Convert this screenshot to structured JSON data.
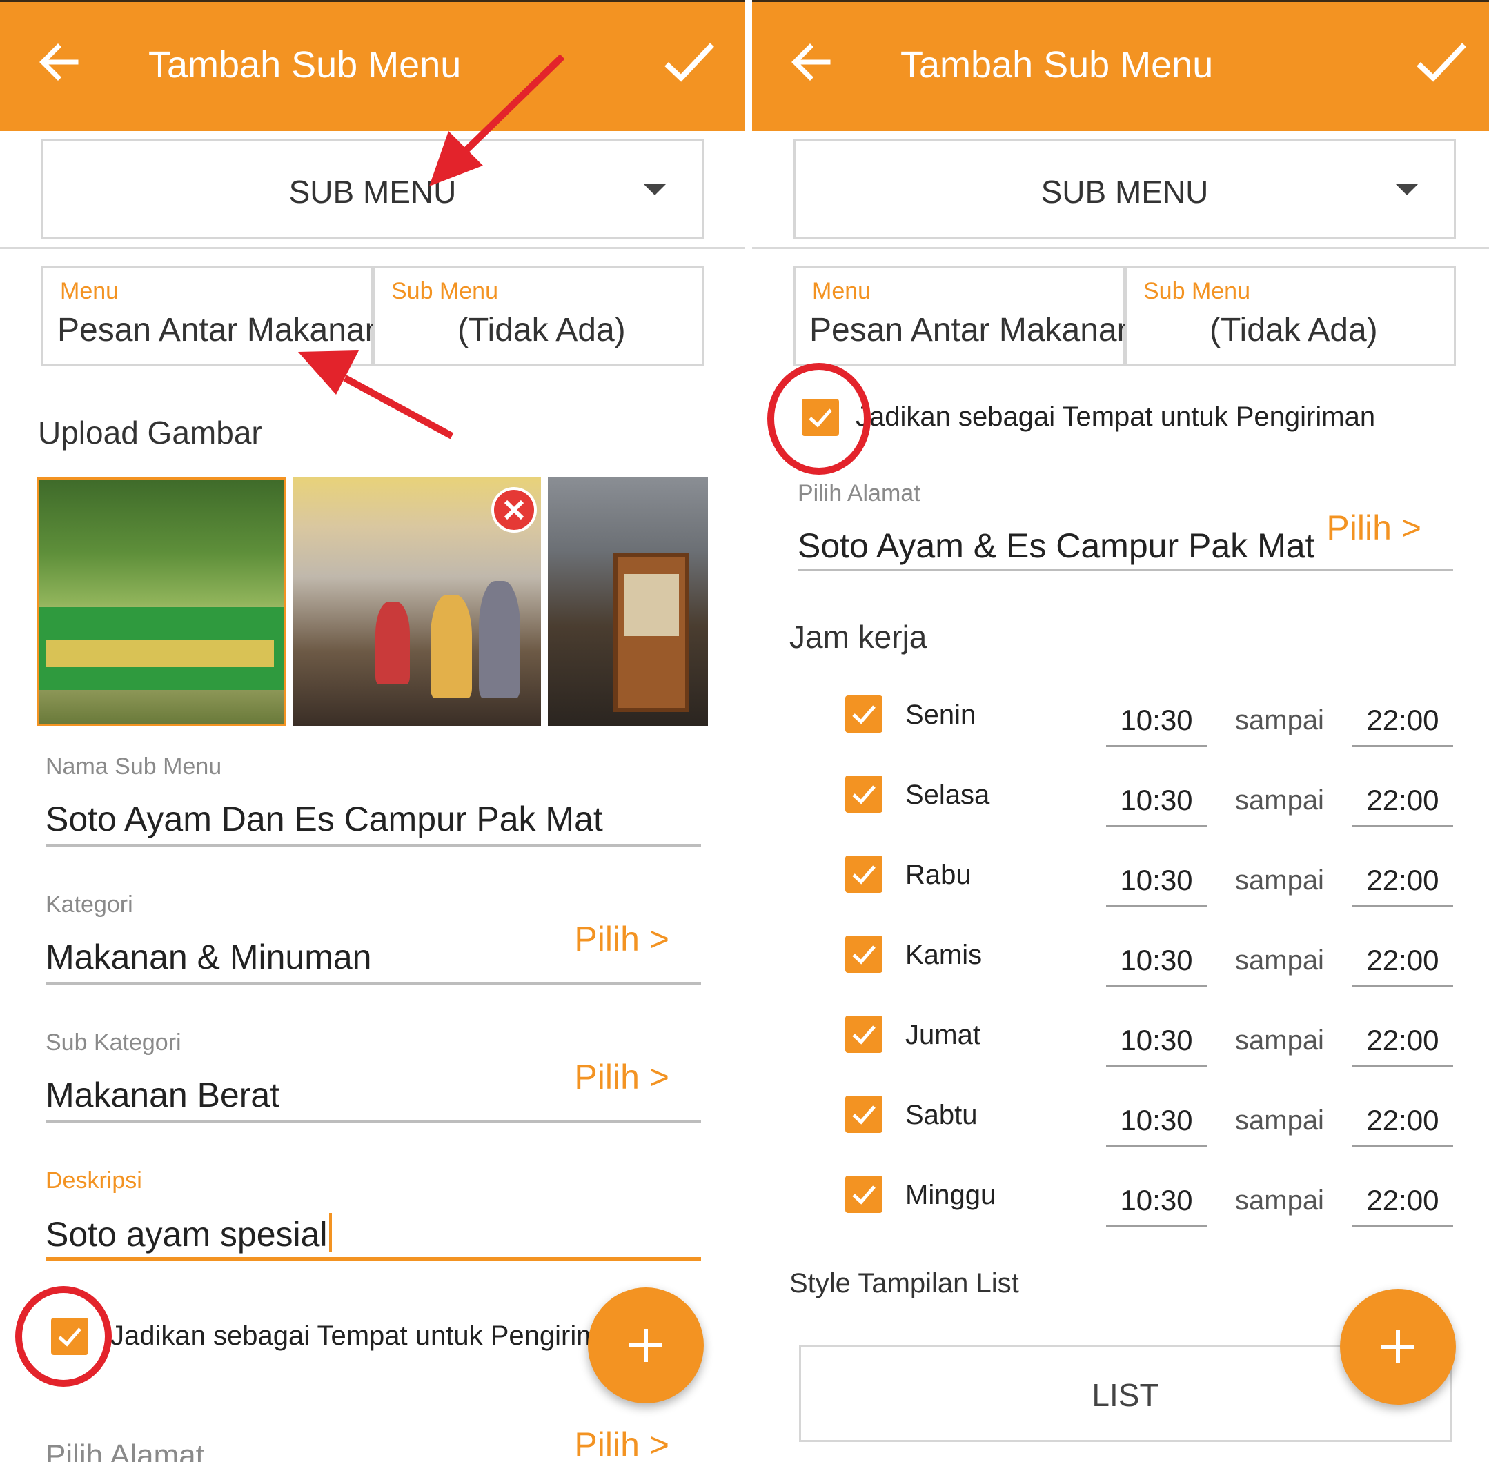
{
  "colors": {
    "accent": "#F39322",
    "annotation": "#E3232B",
    "app_bar_text": "#FFFFFF"
  },
  "left": {
    "app_bar": {
      "title": "Tambah Sub Menu",
      "back_icon": "arrow-left-icon",
      "confirm_icon": "check-icon"
    },
    "type_dropdown": {
      "selected": "SUB MENU",
      "icon": "caret-down-icon"
    },
    "menu": {
      "label": "Menu",
      "value": "Pesan Antar Makanan"
    },
    "sub_menu": {
      "label": "Sub Menu",
      "value": "(Tidak Ada)"
    },
    "upload": {
      "title": "Upload Gambar"
    },
    "nama_sub_menu": {
      "label": "Nama Sub Menu",
      "value": "Soto Ayam Dan Es Campur Pak Mat"
    },
    "kategori": {
      "label": "Kategori",
      "value": "Makanan & Minuman",
      "action": "Pilih >"
    },
    "sub_kategori": {
      "label": "Sub Kategori",
      "value": "Makanan Berat",
      "action": "Pilih >"
    },
    "deskripsi": {
      "label": "Deskripsi",
      "value": "Soto ayam spesial"
    },
    "delivery_checkbox": {
      "label": "Jadikan sebagai Tempat untuk Pengiriman",
      "checked": true
    },
    "pilih_alamat": {
      "label": "Pilih Alamat",
      "action": "Pilih >"
    },
    "fab": {
      "icon": "plus-icon"
    }
  },
  "right": {
    "app_bar": {
      "title": "Tambah Sub Menu",
      "back_icon": "arrow-left-icon",
      "confirm_icon": "check-icon"
    },
    "type_dropdown": {
      "selected": "SUB MENU",
      "icon": "caret-down-icon"
    },
    "menu": {
      "label": "Menu",
      "value": "Pesan Antar Makanan"
    },
    "sub_menu": {
      "label": "Sub Menu",
      "value": "(Tidak Ada)"
    },
    "delivery_checkbox": {
      "label": "Jadikan sebagai Tempat untuk Pengiriman",
      "checked": true
    },
    "pilih_alamat": {
      "label": "Pilih Alamat",
      "value": "Soto Ayam & Es Campur Pak Mat",
      "action": "Pilih >"
    },
    "jam_kerja": {
      "title": "Jam kerja",
      "separator": "sampai",
      "days": [
        {
          "name": "Senin",
          "checked": true,
          "from": "10:30",
          "to": "22:00"
        },
        {
          "name": "Selasa",
          "checked": true,
          "from": "10:30",
          "to": "22:00"
        },
        {
          "name": "Rabu",
          "checked": true,
          "from": "10:30",
          "to": "22:00"
        },
        {
          "name": "Kamis",
          "checked": true,
          "from": "10:30",
          "to": "22:00"
        },
        {
          "name": "Jumat",
          "checked": true,
          "from": "10:30",
          "to": "22:00"
        },
        {
          "name": "Sabtu",
          "checked": true,
          "from": "10:30",
          "to": "22:00"
        },
        {
          "name": "Minggu",
          "checked": true,
          "from": "10:30",
          "to": "22:00"
        }
      ]
    },
    "style": {
      "title": "Style Tampilan List",
      "value": "LIST"
    },
    "fab": {
      "icon": "plus-icon"
    }
  }
}
